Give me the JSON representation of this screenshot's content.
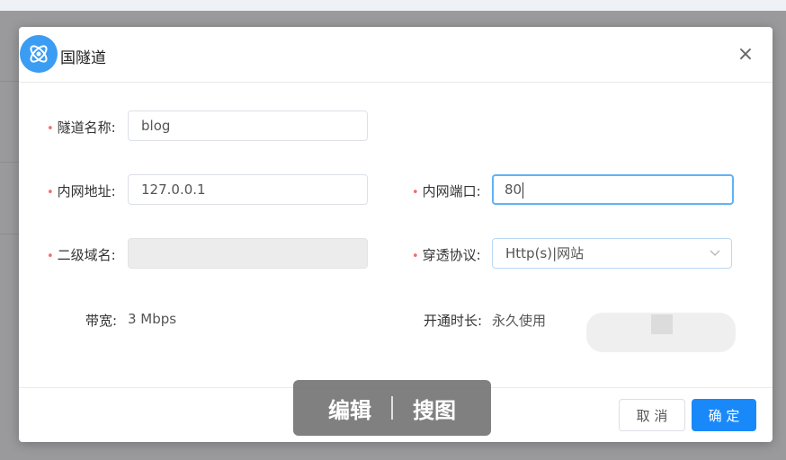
{
  "dialog": {
    "title": "国隧道",
    "close_icon": "×"
  },
  "form": {
    "tunnel_name": {
      "label": "隧道名称:",
      "value": "blog",
      "required": true
    },
    "internal_address": {
      "label": "内网地址:",
      "value": "127.0.0.1",
      "required": true
    },
    "internal_port": {
      "label": "内网端口:",
      "value": "80",
      "required": true
    },
    "subdomain": {
      "label": "二级域名:",
      "value": "",
      "required": true
    },
    "protocol": {
      "label": "穿透协议:",
      "value": "Http(s)|网站",
      "required": true
    },
    "bandwidth": {
      "label": "带宽:",
      "value": "3 Mbps"
    },
    "duration": {
      "label": "开通时长:",
      "value": "永久使用"
    }
  },
  "footer": {
    "cancel_label": "取 消",
    "ok_label": "确 定"
  },
  "overlay": {
    "edit_label": "编辑",
    "search_label": "搜图"
  },
  "colors": {
    "primary": "#1989fa",
    "required_mark": "#f56c6c",
    "focus_border": "#5fb3f6",
    "logo": "#3b9cf3"
  },
  "icons": {
    "logo": "atom-logo-icon",
    "close": "close-icon",
    "select_arrow": "chevron-down-icon"
  }
}
